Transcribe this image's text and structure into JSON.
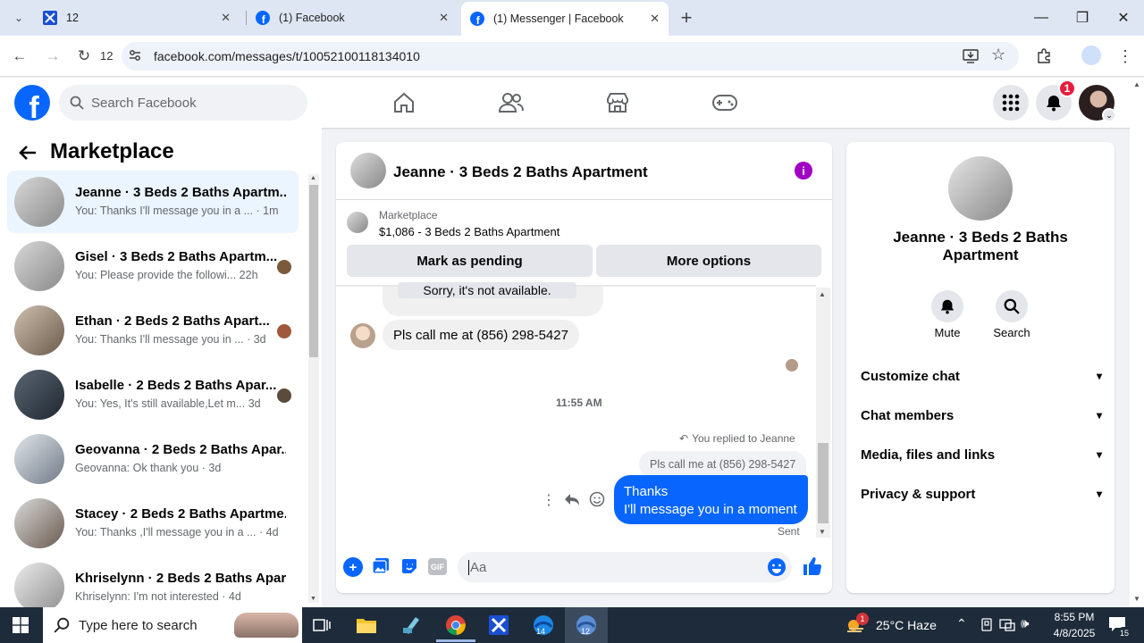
{
  "browser": {
    "tabs": [
      {
        "title": "12"
      },
      {
        "title": "(1) Facebook"
      },
      {
        "title": "(1) Messenger | Facebook"
      }
    ],
    "reload_badge": "12",
    "url": "facebook.com/messages/t/10052100118134010"
  },
  "fb": {
    "search_placeholder": "Search Facebook",
    "notification_count": "1"
  },
  "sidebar": {
    "title": "Marketplace",
    "conversations": [
      {
        "name": "Jeanne · 3 Beds 2 Baths Apartm...",
        "preview": "You: Thanks I'll message you in a ... · 1m"
      },
      {
        "name": "Gisel · 3 Beds 2 Baths Apartm...",
        "preview": "You: Please provide the followi...   22h"
      },
      {
        "name": "Ethan · 2 Beds 2 Baths Apart...",
        "preview": "You: Thanks I'll message you in ... · 3d"
      },
      {
        "name": "Isabelle · 2 Beds 2 Baths Apar...",
        "preview": "You: Yes, It's still available,Let m...   3d"
      },
      {
        "name": "Geovanna · 2 Beds 2 Baths Apar...",
        "preview": "Geovanna: Ok thank you · 3d"
      },
      {
        "name": "Stacey · 2 Beds 2 Baths Apartme...",
        "preview": "You: Thanks ,I'll message you in a ... · 4d"
      },
      {
        "name": "Khriselynn · 2 Beds 2 Baths Apar...",
        "preview": "Khriselynn: I'm not interested · 4d"
      }
    ]
  },
  "chat": {
    "title": "Jeanne · 3 Beds 2 Baths Apartment",
    "listing_source": "Marketplace",
    "listing_title": "$1,086 - 3 Beds 2 Baths Apartment",
    "mark_pending": "Mark as pending",
    "more_options": "More options",
    "msg_partial": "Sorry, it's not available.",
    "msg_phone": "Pls call me at (856) 298-5427",
    "timestamp": "11:55 AM",
    "replied_to": "You replied to Jeanne",
    "quoted": "Pls call me at (856) 298-5427",
    "sent_line1": "Thanks",
    "sent_line2": "I'll message you in a moment",
    "sent_status": "Sent",
    "input_placeholder": "Aa",
    "gif_label": "GIF"
  },
  "details": {
    "name": "Jeanne · 3 Beds 2 Baths Apartment",
    "mute": "Mute",
    "search": "Search",
    "sections": [
      "Customize chat",
      "Chat members",
      "Media, files and links",
      "Privacy & support"
    ]
  },
  "taskbar": {
    "search_placeholder": "Type here to search",
    "weather": "25°C  Haze",
    "weather_badge": "1",
    "time": "8:55 PM",
    "date": "4/8/2025",
    "notif_count": "15",
    "app_badge_1": "14",
    "app_badge_2": "12"
  },
  "colors": {
    "fb_blue": "#0866ff",
    "selected_bg": "#ebf5ff",
    "info_purple": "#a100c4",
    "notif_red": "#e41e3f"
  }
}
